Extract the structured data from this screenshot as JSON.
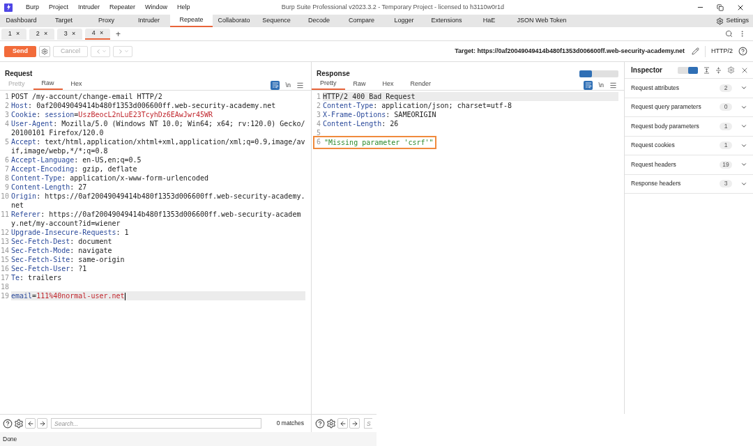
{
  "window": {
    "title": "Burp Suite Professional v2023.3.2 - Temporary Project - licensed to h3110w0r1d"
  },
  "menu": [
    "Burp",
    "Project",
    "Intruder",
    "Repeater",
    "Window",
    "Help"
  ],
  "main_tabs": [
    {
      "label": "Dashboard",
      "selected": false
    },
    {
      "label": "Target",
      "selected": false
    },
    {
      "label": "Proxy",
      "selected": false
    },
    {
      "label": "Intruder",
      "selected": false
    },
    {
      "label": "Repeate",
      "selected": true
    },
    {
      "label": "Collaborato",
      "selected": false
    },
    {
      "label": "Sequence",
      "selected": false
    },
    {
      "label": "Decode",
      "selected": false
    },
    {
      "label": "Compare",
      "selected": false
    },
    {
      "label": "Logger",
      "selected": false
    },
    {
      "label": "Extensions",
      "selected": false
    },
    {
      "label": "HaE",
      "selected": false
    },
    {
      "label": "JSON Web Token",
      "selected": false
    }
  ],
  "settings_label": "Settings",
  "repeater_tabs": [
    {
      "label": "1",
      "close": "×",
      "selected": false
    },
    {
      "label": "2",
      "close": "×",
      "selected": false
    },
    {
      "label": "3",
      "close": "×",
      "selected": false
    },
    {
      "label": "4",
      "close": "×",
      "selected": true
    }
  ],
  "add_tab": "+",
  "toolbar": {
    "send": "Send",
    "cancel": "Cancel",
    "target": "Target: https://0af20049049414b480f1353d006600ff.web-security-academy.net",
    "protocol": "HTTP/2"
  },
  "request": {
    "title": "Request",
    "view_tabs": [
      {
        "label": "Pretty",
        "selected": false,
        "disabled": true
      },
      {
        "label": "Raw",
        "selected": true,
        "disabled": false
      },
      {
        "label": "Hex",
        "selected": false,
        "disabled": false
      }
    ],
    "newline_toggle": "\\n",
    "lines": [
      {
        "number": "1",
        "current": false,
        "parts": [
          {
            "kind": "plain",
            "text": "POST /my-account/change-email HTTP/2"
          }
        ]
      },
      {
        "number": "2",
        "current": false,
        "parts": [
          {
            "kind": "name",
            "text": "Host"
          },
          {
            "kind": "plain",
            "text": ": 0af20049049414b480f1353d006600ff.web-security-academy.net"
          }
        ]
      },
      {
        "number": "3",
        "current": false,
        "parts": [
          {
            "kind": "name",
            "text": "Cookie"
          },
          {
            "kind": "plain",
            "text": ": "
          },
          {
            "kind": "name",
            "text": "session"
          },
          {
            "kind": "plain",
            "text": "="
          },
          {
            "kind": "value",
            "text": "UszBeocL2nLuE23TcyhDz6EAwJwr45WR"
          }
        ]
      },
      {
        "number": "4",
        "current": false,
        "parts": [
          {
            "kind": "name",
            "text": "User-Agent"
          },
          {
            "kind": "plain",
            "text": ": Mozilla/5.0 (Windows NT 10.0; Win64; x64; rv:120.0) Gecko/20100101 Firefox/120.0"
          }
        ]
      },
      {
        "number": "5",
        "current": false,
        "parts": [
          {
            "kind": "name",
            "text": "Accept"
          },
          {
            "kind": "plain",
            "text": ": text/html,application/xhtml+xml,application/xml;q=0.9,image/avif,image/webp,*/*;q=0.8"
          }
        ]
      },
      {
        "number": "6",
        "current": false,
        "parts": [
          {
            "kind": "name",
            "text": "Accept-Language"
          },
          {
            "kind": "plain",
            "text": ": en-US,en;q=0.5"
          }
        ]
      },
      {
        "number": "7",
        "current": false,
        "parts": [
          {
            "kind": "name",
            "text": "Accept-Encoding"
          },
          {
            "kind": "plain",
            "text": ": gzip, deflate"
          }
        ]
      },
      {
        "number": "8",
        "current": false,
        "parts": [
          {
            "kind": "name",
            "text": "Content-Type"
          },
          {
            "kind": "plain",
            "text": ": application/x-www-form-urlencoded"
          }
        ]
      },
      {
        "number": "9",
        "current": false,
        "parts": [
          {
            "kind": "name",
            "text": "Content-Length"
          },
          {
            "kind": "plain",
            "text": ": 27"
          }
        ]
      },
      {
        "number": "10",
        "current": false,
        "parts": [
          {
            "kind": "name",
            "text": "Origin"
          },
          {
            "kind": "plain",
            "text": ": https://0af20049049414b480f1353d006600ff.web-security-academy.net"
          }
        ]
      },
      {
        "number": "11",
        "current": false,
        "parts": [
          {
            "kind": "name",
            "text": "Referer"
          },
          {
            "kind": "plain",
            "text": ": https://0af20049049414b480f1353d006600ff.web-security-academy.net/my-account?id=wiener"
          }
        ]
      },
      {
        "number": "12",
        "current": false,
        "parts": [
          {
            "kind": "name",
            "text": "Upgrade-Insecure-Requests"
          },
          {
            "kind": "plain",
            "text": ": 1"
          }
        ]
      },
      {
        "number": "13",
        "current": false,
        "parts": [
          {
            "kind": "name",
            "text": "Sec-Fetch-Dest"
          },
          {
            "kind": "plain",
            "text": ": document"
          }
        ]
      },
      {
        "number": "14",
        "current": false,
        "parts": [
          {
            "kind": "name",
            "text": "Sec-Fetch-Mode"
          },
          {
            "kind": "plain",
            "text": ": navigate"
          }
        ]
      },
      {
        "number": "15",
        "current": false,
        "parts": [
          {
            "kind": "name",
            "text": "Sec-Fetch-Site"
          },
          {
            "kind": "plain",
            "text": ": same-origin"
          }
        ]
      },
      {
        "number": "16",
        "current": false,
        "parts": [
          {
            "kind": "name",
            "text": "Sec-Fetch-User"
          },
          {
            "kind": "plain",
            "text": ": ?1"
          }
        ]
      },
      {
        "number": "17",
        "current": false,
        "parts": [
          {
            "kind": "name",
            "text": "Te"
          },
          {
            "kind": "plain",
            "text": ": trailers"
          }
        ]
      },
      {
        "number": "18",
        "current": false
      },
      {
        "number": "19",
        "current": true,
        "parts": [
          {
            "kind": "name",
            "text": "email"
          },
          {
            "kind": "plain",
            "text": "="
          },
          {
            "kind": "value",
            "text": "111%40normal-user.net"
          }
        ]
      }
    ],
    "search": {
      "placeholder": "Search...",
      "matches": "0 matches"
    }
  },
  "response": {
    "title": "Response",
    "view_tabs": [
      {
        "label": "Pretty",
        "selected": true,
        "disabled": false
      },
      {
        "label": "Raw",
        "selected": false,
        "disabled": false
      },
      {
        "label": "Hex",
        "selected": false,
        "disabled": false
      },
      {
        "label": "Render",
        "selected": false,
        "disabled": false
      }
    ],
    "newline_toggle": "\\n",
    "lines": [
      {
        "number": "1",
        "current": true,
        "boxed": false,
        "parts": [
          {
            "kind": "plain",
            "text": "HTTP/2 400 Bad Request"
          }
        ]
      },
      {
        "number": "2",
        "current": false,
        "boxed": false,
        "parts": [
          {
            "kind": "name",
            "text": "Content-Type"
          },
          {
            "kind": "plain",
            "text": ": application/json; charset=utf-8"
          }
        ]
      },
      {
        "number": "3",
        "current": false,
        "boxed": false,
        "parts": [
          {
            "kind": "name",
            "text": "X-Frame-Options"
          },
          {
            "kind": "plain",
            "text": ": SAMEORIGIN"
          }
        ]
      },
      {
        "number": "4",
        "current": false,
        "boxed": false,
        "parts": [
          {
            "kind": "name",
            "text": "Content-Length"
          },
          {
            "kind": "plain",
            "text": ": 26"
          }
        ]
      },
      {
        "number": "5",
        "current": false,
        "boxed": false
      },
      {
        "number": "6",
        "current": false,
        "boxed": true,
        "parts": [
          {
            "kind": "string",
            "text": "\"Missing parameter 'csrf'\""
          }
        ]
      }
    ],
    "search": {
      "placeholder": "S"
    }
  },
  "inspector": {
    "title": "Inspector",
    "sections": [
      {
        "label": "Request attributes",
        "count": "2"
      },
      {
        "label": "Request query parameters",
        "count": "0"
      },
      {
        "label": "Request body parameters",
        "count": "1"
      },
      {
        "label": "Request cookies",
        "count": "1"
      },
      {
        "label": "Request headers",
        "count": "19"
      },
      {
        "label": "Response headers",
        "count": "3"
      }
    ]
  },
  "status_bar": "Done"
}
